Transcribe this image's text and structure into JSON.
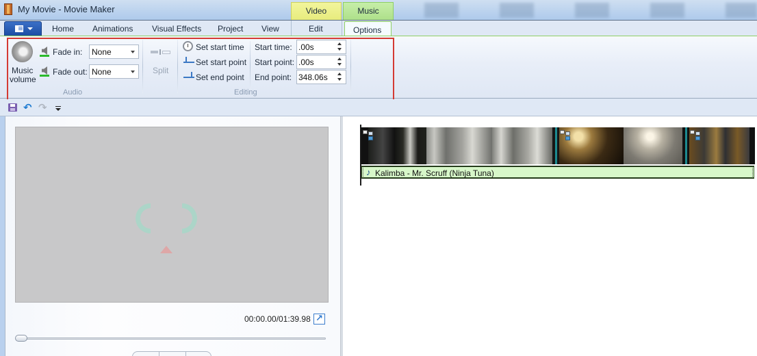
{
  "window": {
    "title": "My Movie - Movie Maker"
  },
  "contextual_tabs": {
    "video_tools": "Video Tools",
    "music_tools": "Music Tools"
  },
  "tabs": [
    {
      "label": "Home"
    },
    {
      "label": "Animations"
    },
    {
      "label": "Visual Effects"
    },
    {
      "label": "Project"
    },
    {
      "label": "View"
    },
    {
      "label": "Edit"
    },
    {
      "label": "Options",
      "selected": true
    }
  ],
  "ribbon": {
    "audio_group": {
      "label": "Audio",
      "music_volume_line1": "Music",
      "music_volume_line2": "volume",
      "fade_in_label": "Fade in:",
      "fade_in_value": "None",
      "fade_out_label": "Fade out:",
      "fade_out_value": "None"
    },
    "split_label": "Split",
    "editing_group": {
      "label": "Editing",
      "set_start_time": "Set start time",
      "set_start_point": "Set start point",
      "set_end_point": "Set end point",
      "start_time_label": "Start time:",
      "start_time_value": ".00s",
      "start_point_label": "Start point:",
      "start_point_value": ".00s",
      "end_point_label": "End point:",
      "end_point_value": "348.06s"
    }
  },
  "colors": {
    "highlight_box": "#d43a33",
    "video_tools_tab": "#e7ec7d",
    "music_tools_tab": "#aee08a",
    "music_track": "#d7f7c9"
  },
  "preview": {
    "timecode": "00:00.00/01:39.98",
    "seek_position_fraction": 0.0
  },
  "storyboard": {
    "clips": [
      {
        "name": "clip-1",
        "frames": 3
      },
      {
        "name": "clip-2",
        "frames": 2
      },
      {
        "name": "clip-3",
        "frames": 1
      }
    ],
    "music_track_title": "Kalimba - Mr. Scruff (Ninja Tuna)"
  }
}
